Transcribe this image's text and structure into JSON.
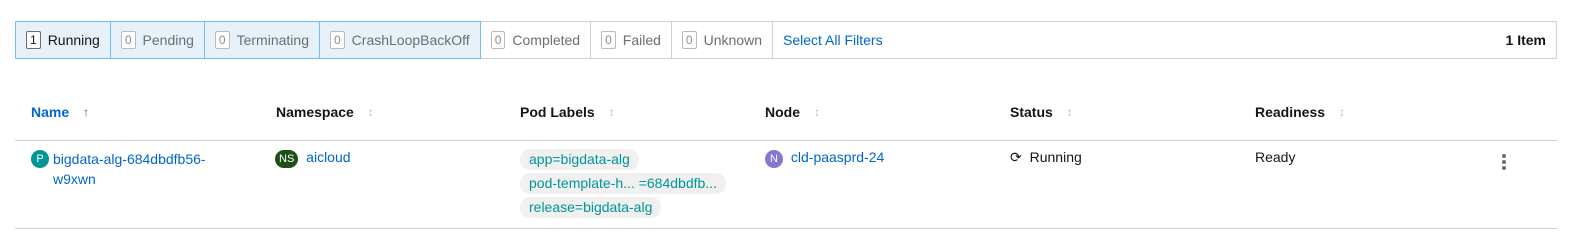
{
  "filters": [
    {
      "count": "1",
      "label": "Running",
      "selected": true
    },
    {
      "count": "0",
      "label": "Pending",
      "selected": true
    },
    {
      "count": "0",
      "label": "Terminating",
      "selected": true
    },
    {
      "count": "0",
      "label": "CrashLoopBackOff",
      "selected": true
    },
    {
      "count": "0",
      "label": "Completed",
      "selected": false
    },
    {
      "count": "0",
      "label": "Failed",
      "selected": false
    },
    {
      "count": "0",
      "label": "Unknown",
      "selected": false
    }
  ],
  "select_all_label": "Select All Filters",
  "item_count": "1 Item",
  "columns": {
    "name": "Name",
    "namespace": "Namespace",
    "pod_labels": "Pod Labels",
    "node": "Node",
    "status": "Status",
    "readiness": "Readiness"
  },
  "sort_icons": {
    "active": "↑",
    "inactive": "↕"
  },
  "row": {
    "pod_badge": "P",
    "pod_name": "bigdata-alg-684dbdfb56-w9xwn",
    "ns_badge": "NS",
    "namespace": "aicloud",
    "labels": [
      "app=bigdata-alg",
      "pod-template-h... =684dbdfb...",
      "release=bigdata-alg"
    ],
    "node_badge": "N",
    "node": "cld-paasprd-24",
    "status_icon": "⟳",
    "status": "Running",
    "readiness": "Ready"
  },
  "colors": {
    "accent": "#0066cc",
    "pod_badge": "#009596",
    "ns_badge": "#1e4f18",
    "node_badge": "#8476d1",
    "label_text": "#009596"
  }
}
